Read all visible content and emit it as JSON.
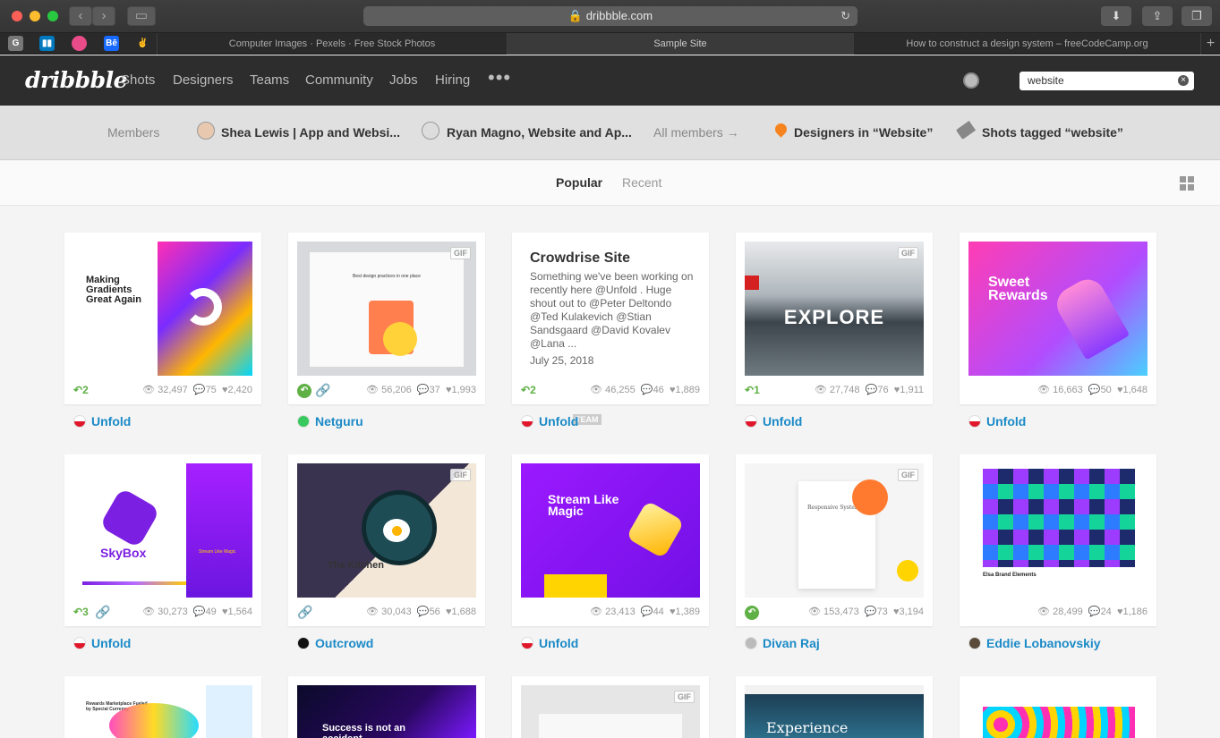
{
  "browser": {
    "url": "dribbble.com",
    "tabs": [
      "Computer Images · Pexels · Free Stock Photos",
      "Sample Site",
      "How to construct a design system – freeCodeCamp.org"
    ],
    "bookmarks": [
      "G",
      "Trello",
      "Dribbble",
      "Bē",
      "Dev"
    ]
  },
  "header": {
    "logo": "dribbble",
    "nav": [
      "Shots",
      "Designers",
      "Teams",
      "Community",
      "Jobs",
      "Hiring"
    ],
    "more": "•••",
    "search_value": "website"
  },
  "subnav": {
    "members_label": "Members",
    "member1": "Shea Lewis | App and Websi...",
    "member2": "Ryan Magno, Website and Ap...",
    "all_members": "All members →",
    "designers": "Designers in “Website”",
    "shots_tagged": "Shots tagged “website”"
  },
  "filter": {
    "popular": "Popular",
    "recent": "Recent"
  },
  "shots": [
    {
      "thumb_title": "Making Gradients Great Again",
      "rebounds": "2",
      "views": "32,497",
      "comments": "75",
      "likes": "2,420",
      "author": "Unfold"
    },
    {
      "thumb_title": "Best design practices in one place",
      "views": "56,206",
      "comments": "37",
      "likes": "1,993",
      "author": "Netguru",
      "gif": "GIF"
    },
    {
      "title": "Crowdrise Site",
      "description": "Something we've been working on recently here @Unfold . Huge shout out to @Peter Deltondo @Ted Kulakevich @Stian Sandsgaard @David Kovalev @Lana ...",
      "date": "July 25, 2018",
      "rebounds": "2",
      "views": "46,255",
      "comments": "46",
      "likes": "1,889",
      "author": "Unfold",
      "team": "TEAM"
    },
    {
      "thumb_title": "EXPLORE",
      "rebounds": "1",
      "views": "27,748",
      "comments": "76",
      "likes": "1,911",
      "author": "Unfold",
      "gif": "GIF"
    },
    {
      "thumb_title": "Sweet Rewards",
      "views": "16,663",
      "comments": "50",
      "likes": "1,648",
      "author": "Unfold"
    },
    {
      "thumb_title": "SkyBox",
      "thumb_sub": "Stream Like Magic",
      "rebounds": "3",
      "views": "30,273",
      "comments": "49",
      "likes": "1,564",
      "author": "Unfold"
    },
    {
      "thumb_title": "The Kitchen",
      "views": "30,043",
      "comments": "56",
      "likes": "1,688",
      "author": "Outcrowd",
      "gif": "GIF"
    },
    {
      "thumb_title": "Stream Like Magic",
      "views": "23,413",
      "comments": "44",
      "likes": "1,389",
      "author": "Unfold"
    },
    {
      "thumb_title": "Responsive System",
      "views": "153,473",
      "comments": "73",
      "likes": "3,194",
      "author": "Divan Raj",
      "gif": "GIF"
    },
    {
      "thumb_title": "Elsa Brand Elements",
      "views": "28,499",
      "comments": "24",
      "likes": "1,186",
      "author": "Eddie Lobanovskiy"
    },
    {
      "thumb_title": "Rewards Marketplace Fueled by Special Currency"
    },
    {
      "thumb_title": "Success is not an accident"
    },
    {
      "gif": "GIF"
    },
    {
      "thumb_title": "Experience"
    },
    {}
  ]
}
